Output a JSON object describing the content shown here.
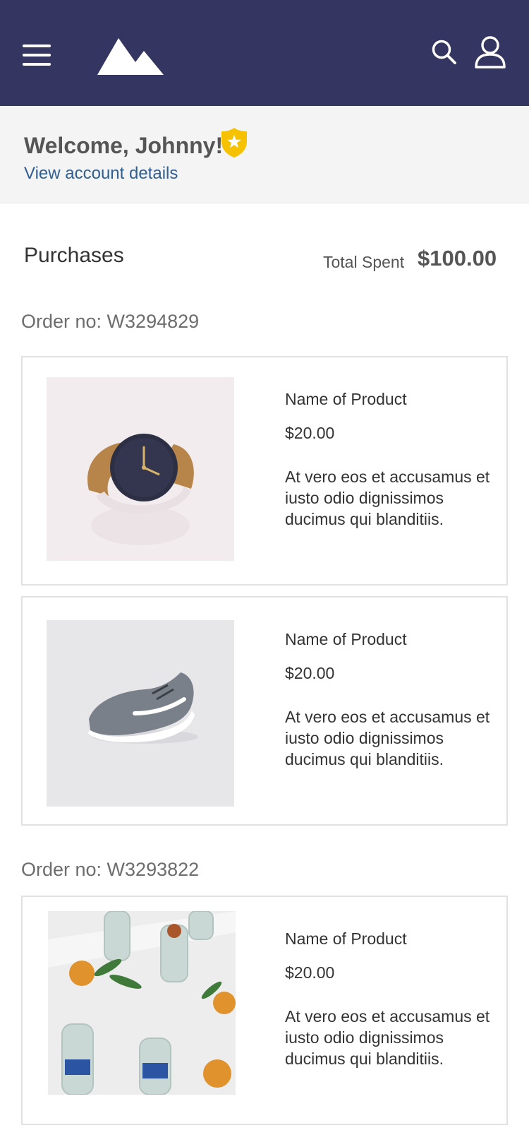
{
  "header": {
    "menu_icon": "hamburger-menu-icon",
    "logo_icon": "mountain-logo-icon",
    "search_icon": "search-icon",
    "account_icon": "user-profile-icon",
    "background_color": "#343661"
  },
  "welcome": {
    "title": "Welcome, Johnny!",
    "badge_icon": "gold-member-badge-icon",
    "account_link": "View account details",
    "link_color": "#2f5f93",
    "badge_color": "#f6c200"
  },
  "purchases": {
    "title": "Purchases",
    "total_label": "Total Spent",
    "total_value": "$100.00"
  },
  "orders": [
    {
      "order_no": "Order no: W3294829",
      "items": [
        {
          "image": "wristwatch-product-image",
          "name": "Name of Product",
          "price": "$20.00",
          "description": "At vero eos et accusamus et iusto odio dignissimos ducimus qui blanditiis."
        },
        {
          "image": "sneaker-product-image",
          "name": "Name of Product",
          "price": "$20.00",
          "description": "At vero eos et accusamus et iusto odio dignissimos ducimus qui blanditiis."
        }
      ]
    },
    {
      "order_no": "Order no: W3293822",
      "items": [
        {
          "image": "water-bottles-oranges-product-image",
          "name": "Name of Product",
          "price": "$20.00",
          "description": "At vero eos et accusamus et iusto odio dignissimos ducimus qui blanditiis."
        }
      ]
    }
  ]
}
